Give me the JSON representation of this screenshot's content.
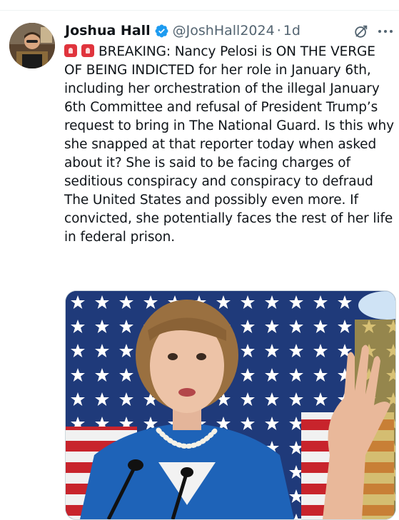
{
  "tweet": {
    "author_name": "Joshua Hall",
    "handle": "@JoshHall2024",
    "separator": "·",
    "time": "1d",
    "text": "BREAKING: Nancy Pelosi is ON THE VERGE OF BEING INDICTED for her role in January 6th, including her orchestration of the illegal January 6th Committee and refusal of President Trump’s request to bring in The National Guard. Is this why she snapped at that reporter today when asked about it? She is said to be facing charges of seditious conspiracy and conspiracy to defraud The United States and possibly even more. If convicted, she potentially faces the rest of her life in federal prison.",
    "leading_emojis": [
      "siren-emoji",
      "siren-emoji"
    ]
  },
  "icons": {
    "verified": "verified-badge-icon",
    "grok": "grok-icon",
    "more": "more-icon"
  },
  "colors": {
    "verified_blue": "#1d9bf0",
    "secondary_text": "#536471",
    "primary_text": "#0f1419"
  }
}
